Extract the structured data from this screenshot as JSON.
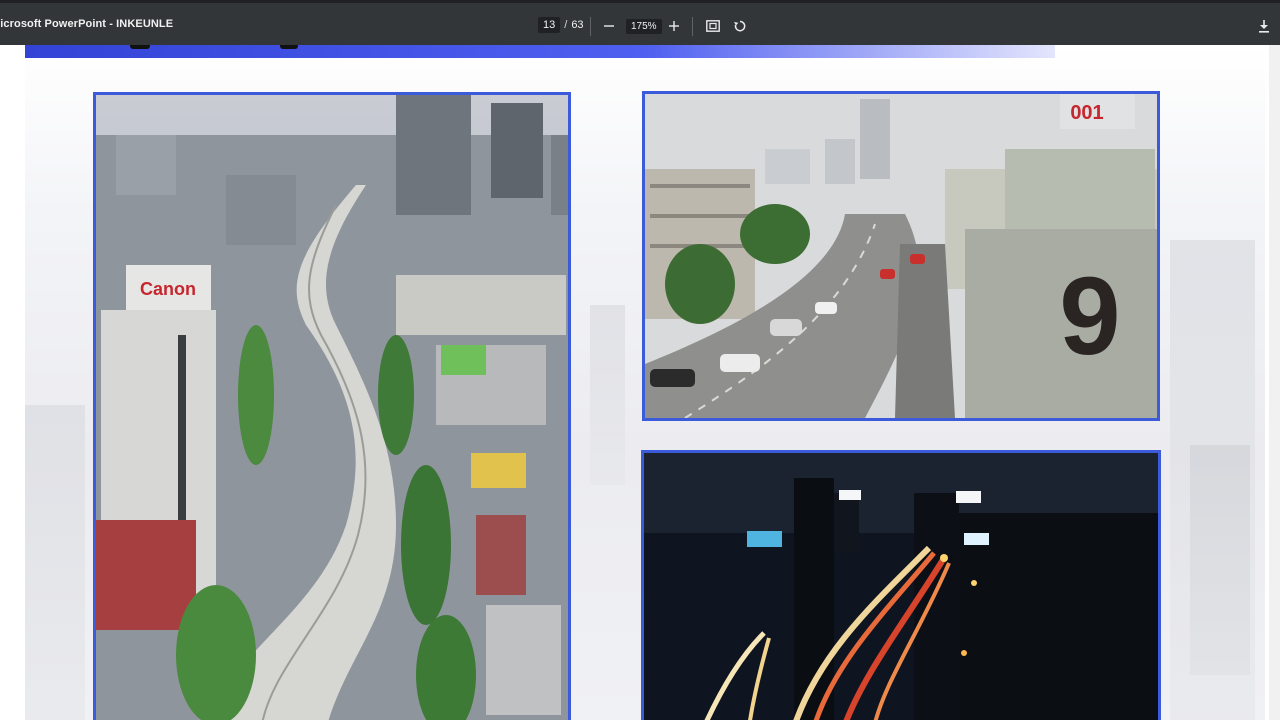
{
  "toolbar": {
    "title": "Microsoft PowerPoint - INKEUNLE",
    "current_page": "13",
    "page_separator": "/",
    "total_pages": "63",
    "zoom": "175%",
    "icons": {
      "zoom_out": "minus-icon",
      "zoom_in": "plus-icon",
      "fit_page": "fit-page-icon",
      "rotate": "rotate-icon",
      "download": "download-icon"
    }
  },
  "slide": {
    "accent_color": "#3b5bdb",
    "photos": [
      {
        "name": "elevated-highway-aerial",
        "sign_text": "Canon"
      },
      {
        "name": "elevated-highway-daytime",
        "sign_text": "001"
      },
      {
        "name": "highway-night-light-trails"
      }
    ],
    "wall_number": "9"
  }
}
